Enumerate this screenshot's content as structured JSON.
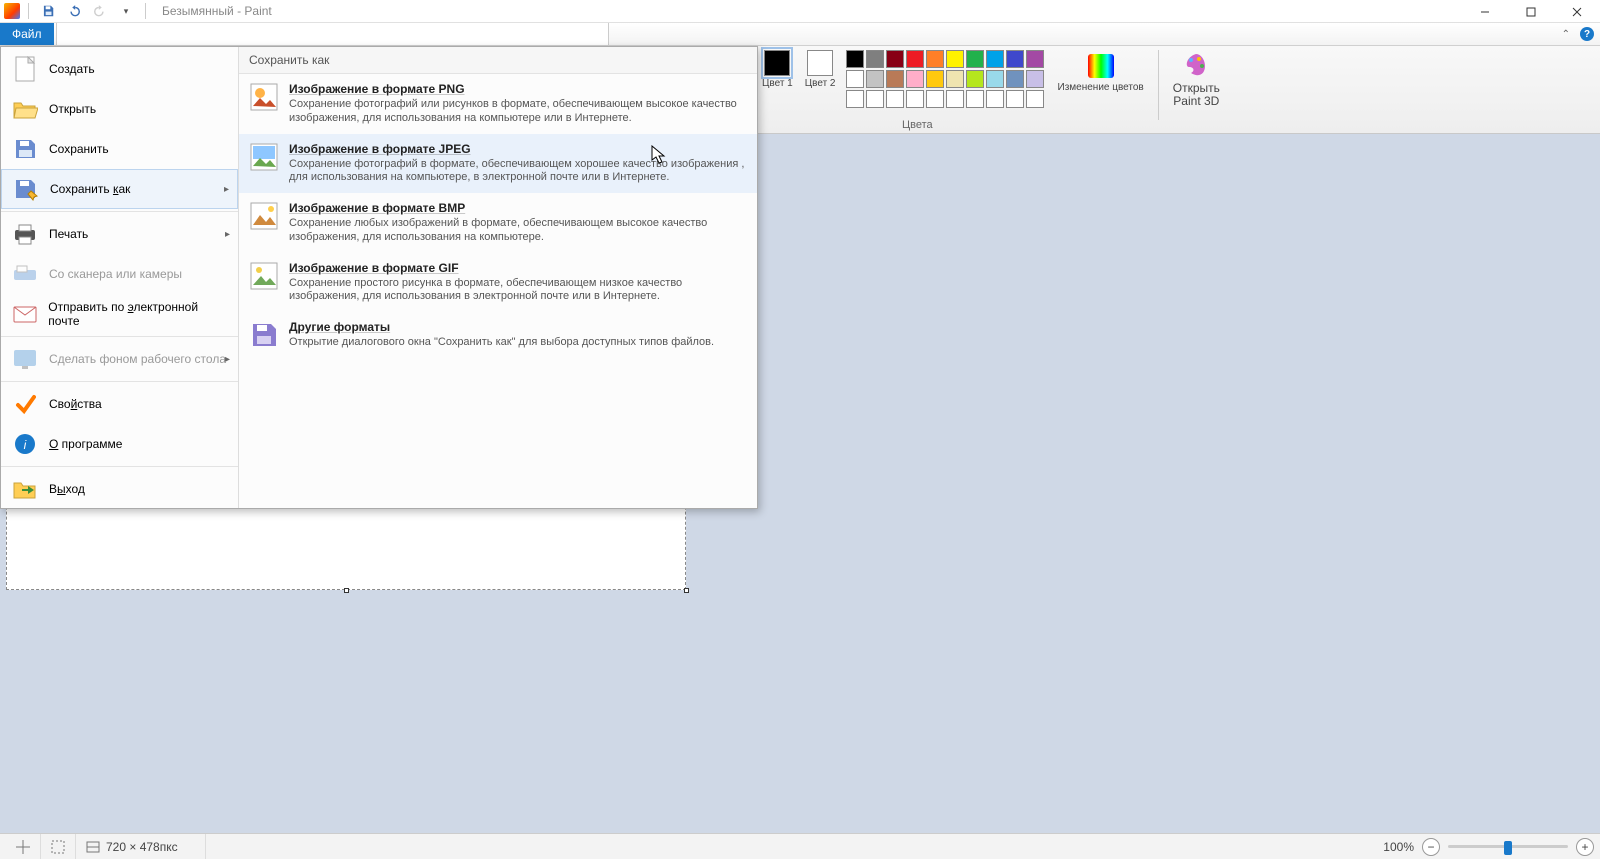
{
  "title": "Безымянный - Paint",
  "tabs": {
    "file": "Файл"
  },
  "file_menu": {
    "create": "Создать",
    "open": "Открыть",
    "save": "Сохранить",
    "save_as": "Сохранить как",
    "print": "Печать",
    "scanner": "Со сканера или камеры",
    "email": "Отправить по электронной почте",
    "wallpaper": "Сделать фоном рабочего стола",
    "properties": "Свойства",
    "about": "О программе",
    "exit": "Выход"
  },
  "save_as_panel": {
    "header": "Сохранить как",
    "formats": [
      {
        "title": "Изображение в формате PNG",
        "desc": "Сохранение фотографий или рисунков в формате, обеспечивающем высокое качество изображения, для использования на компьютере или в Интернете."
      },
      {
        "title": "Изображение в формате JPEG",
        "desc": "Сохранение фотографий в формате, обеспечивающем хорошее качество изображения , для использования на компьютере, в электронной почте или в Интернете."
      },
      {
        "title": "Изображение в формате BMP",
        "desc": "Сохранение любых изображений в формате, обеспечивающем высокое качество изображения, для использования на компьютере."
      },
      {
        "title": "Изображение в формате GIF",
        "desc": "Сохранение простого рисунка в формате, обеспечивающем низкое качество изображения, для использования в электронной почте или в Интернете."
      },
      {
        "title": "Другие форматы",
        "desc": "Открытие диалогового окна \"Сохранить как\" для выбора доступных типов файлов."
      }
    ]
  },
  "ribbon": {
    "color1": "Цвет 1",
    "color2": "Цвет 2",
    "edit_colors": "Изменение цветов",
    "paint3d_l1": "Открыть",
    "paint3d_l2": "Paint 3D",
    "group_colors": "Цвета",
    "palette_top": [
      "#000000",
      "#7f7f7f",
      "#880015",
      "#ed1c24",
      "#ff7f27",
      "#fff200",
      "#22b14c",
      "#00a2e8",
      "#3f48cc",
      "#a349a4"
    ],
    "palette_mid": [
      "#ffffff",
      "#c3c3c3",
      "#b97a57",
      "#ffaec9",
      "#ffc90e",
      "#efe4b0",
      "#b5e61d",
      "#99d9ea",
      "#7092be",
      "#c8bfe7"
    ],
    "palette_bottom": [
      "#ffffff",
      "#ffffff",
      "#ffffff",
      "#ffffff",
      "#ffffff",
      "#ffffff",
      "#ffffff",
      "#ffffff",
      "#ffffff",
      "#ffffff"
    ]
  },
  "status": {
    "dims": "720 × 478пкс",
    "zoom": "100%"
  }
}
